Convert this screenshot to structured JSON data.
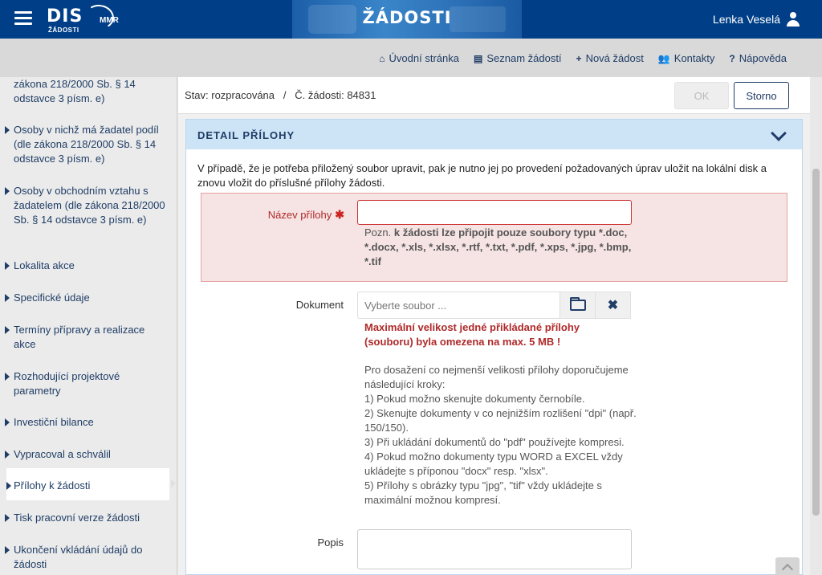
{
  "header": {
    "logo_text": "DIS",
    "logo_sub": "ŽÁDOSTI",
    "logo_mmr": "MMR",
    "banner_title": "ŽÁDOSTI",
    "user_name": "Lenka Veselá"
  },
  "nav": [
    {
      "icon": "home-icon",
      "glyph": "⌂",
      "label": "Úvodní stránka"
    },
    {
      "icon": "list-icon",
      "glyph": "▤",
      "label": "Seznam žádostí"
    },
    {
      "icon": "plus-icon",
      "glyph": "+",
      "label": "Nová žádost"
    },
    {
      "icon": "users-icon",
      "glyph": "👥",
      "label": "Kontakty"
    },
    {
      "icon": "help-icon",
      "glyph": "?",
      "label": "Nápověda"
    }
  ],
  "sidebar": {
    "items": [
      {
        "label": "zákona 218/2000 Sb. § 14 odstavce 3 písm. e)"
      },
      {
        "label": "Osoby v nichž má žadatel podíl (dle zákona 218/2000 Sb. § 14 odstavce 3 písm. e)"
      },
      {
        "label": "Osoby v obchodním vztahu s žadatelem (dle zákona 218/2000 Sb. § 14 odstavce 3 písm. e)"
      },
      {
        "label": "Lokalita akce"
      },
      {
        "label": "Specifické údaje"
      },
      {
        "label": "Termíny přípravy a realizace akce"
      },
      {
        "label": "Rozhodující projektové parametry"
      },
      {
        "label": "Investiční bilance"
      },
      {
        "label": "Vypracoval a schválil"
      },
      {
        "label": "Přílohy k žádosti"
      },
      {
        "label": "Tisk pracovní verze žádosti"
      },
      {
        "label": "Ukončení vkládání údajů do žádosti"
      }
    ]
  },
  "status": {
    "text": "Stav: rozpracována   /   Č. žádosti: 84831",
    "ok_label": "OK",
    "storno_label": "Storno"
  },
  "panel": {
    "title": "DETAIL PŘÍLOHY",
    "intro": "V případě, že je potřeba přiložený soubor upravit, pak je nutno jej po provedení požadovaných úprav uložit na lokální disk a znovu vložit do příslušné přílohy žádosti.",
    "name_label": "Název přílohy",
    "name_required": "✱",
    "name_value": "",
    "pozn_prefix": "Pozn.",
    "pozn_text": "k žádosti lze připojit pouze soubory typu *.doc, *.docx, *.xls, *.xlsx, *.rtf, *.txt, *.pdf, *.xps, *.jpg, *.bmp, *.tif",
    "doc_label": "Dokument",
    "doc_placeholder": "Vyberte soubor ...",
    "max_size": "Maximální velikost jedné přikládané přílohy (souboru) byla omezena na max. 5 MB !",
    "tips": "Pro dosažení co nejmenší velikosti přílohy doporučujeme následující kroky:\n1) Pokud možno skenujte dokumenty černobíle.\n2) Skenujte dokumenty v co nejnižším rozlišení \"dpi\" (např. 150/150).\n3) Při ukládání dokumentů do \"pdf\" používejte kompresi.\n4) Pokud možno dokumenty typu WORD a EXCEL vždy ukládejte s příponou \"docx\" resp. \"xlsx\".\n5) Přílohy s obrázky typu \"jpg\", \"tif\" vždy ukládejte s maximální možnou kompresí.",
    "popis_label": "Popis",
    "popis_value": ""
  },
  "colors": {
    "header_bg": "#003f87",
    "accent": "#1f3d66",
    "error": "#b02a2a"
  }
}
